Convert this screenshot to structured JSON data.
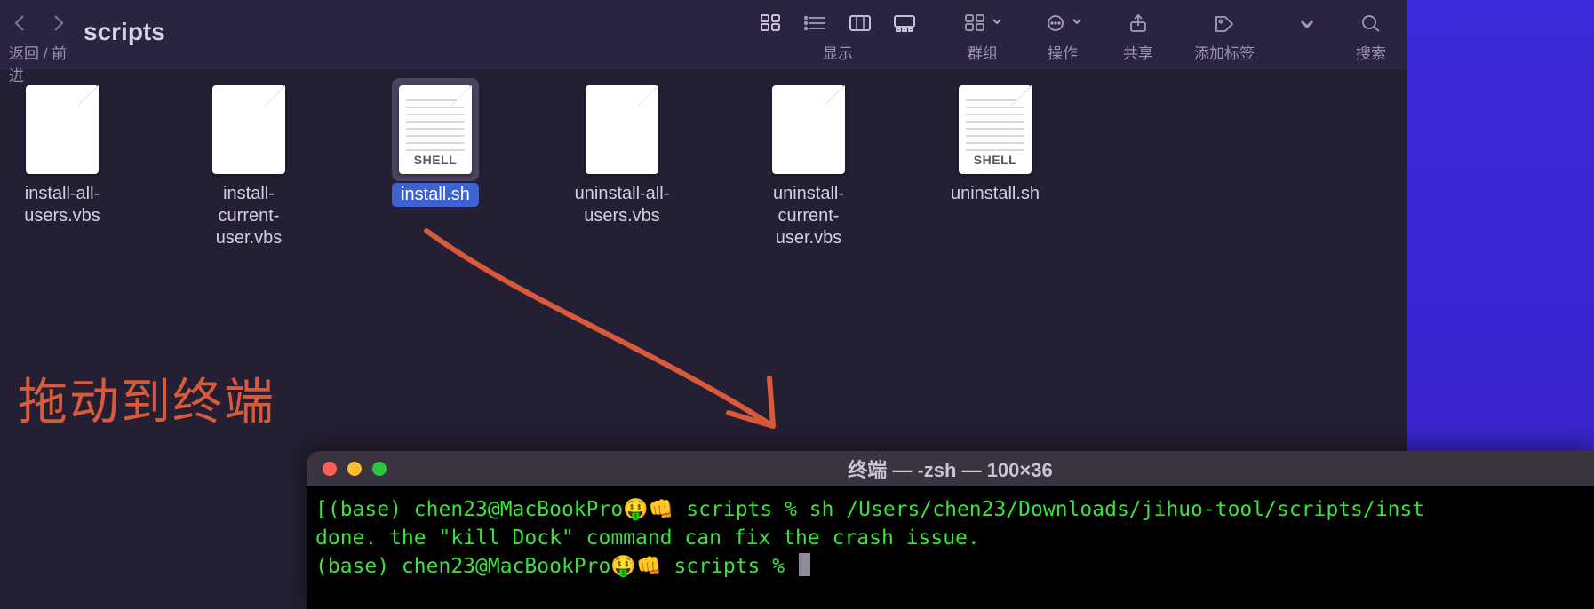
{
  "finder": {
    "folder_title": "scripts",
    "nav_caption": "返回 / 前进",
    "toolbar": {
      "view_caption": "显示",
      "group_caption": "群组",
      "action_caption": "操作",
      "share_caption": "共享",
      "tag_caption": "添加标签",
      "search_caption": "搜索"
    },
    "files": [
      {
        "name": "install-all-users.vbs",
        "type": "plain",
        "selected": false
      },
      {
        "name": "install-current-user.vbs",
        "type": "plain",
        "selected": false
      },
      {
        "name": "install.sh",
        "type": "shell",
        "selected": true
      },
      {
        "name": "uninstall-all-users.vbs",
        "type": "plain",
        "selected": false
      },
      {
        "name": "uninstall-current-user.vbs",
        "type": "plain",
        "selected": false
      },
      {
        "name": "uninstall.sh",
        "type": "shell",
        "selected": false
      }
    ],
    "shell_badge": "SHELL"
  },
  "annotation": {
    "text": "拖动到终端"
  },
  "terminal": {
    "title": "终端 — -zsh — 100×36",
    "lines": [
      "[(base) chen23@MacBookPro🤑👊 scripts % sh /Users/chen23/Downloads/jihuo-tool/scripts/inst",
      "done. the \"kill Dock\" command can fix the crash issue.",
      "(base) chen23@MacBookPro🤑👊 scripts % "
    ]
  }
}
